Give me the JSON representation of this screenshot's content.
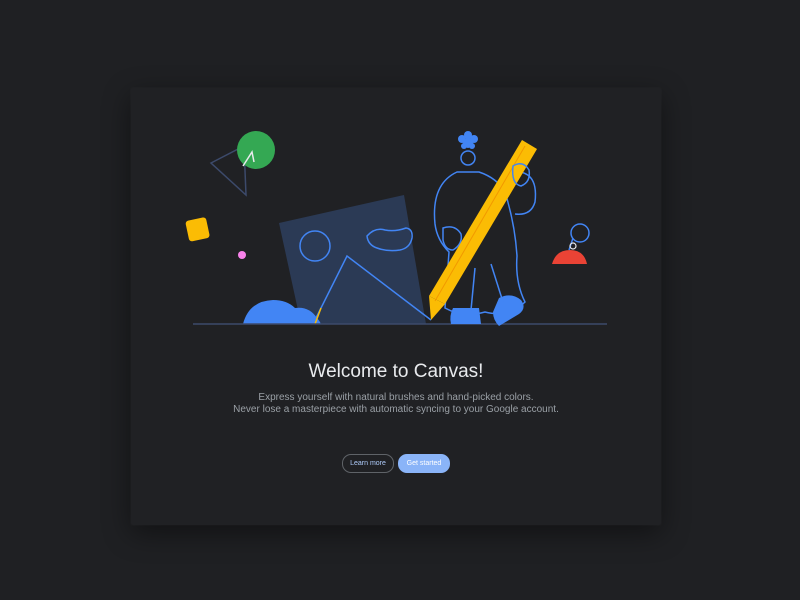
{
  "dialog": {
    "title": "Welcome to Canvas!",
    "subtitle_line1": "Express yourself with natural brushes and hand-picked colors.",
    "subtitle_line2": "Never lose a masterpiece with automatic syncing to your Google account.",
    "learn_more_label": "Learn more",
    "get_started_label": "Get started"
  },
  "colors": {
    "background": "#1f2023",
    "dialog": "#202124",
    "accent_blue": "#8ab4f8",
    "illustration_blue": "#4285f4",
    "yellow": "#fbbc04",
    "green": "#34a853",
    "red": "#ea4335",
    "pink": "#f882ea"
  },
  "illustration": {
    "icons": [
      "triangle-icon",
      "green-circle-icon",
      "yellow-square-icon",
      "pink-dot-icon",
      "picture-frame-icon",
      "person-icon",
      "pencil-icon",
      "blue-blob-icon",
      "red-stamp-icon"
    ]
  }
}
